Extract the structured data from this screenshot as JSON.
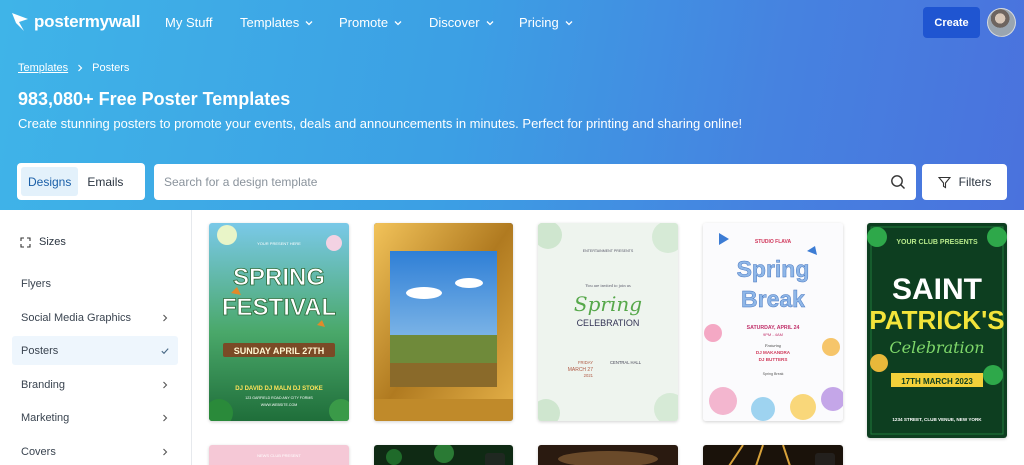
{
  "nav": {
    "logo_text": "postermywall",
    "links": [
      "My Stuff",
      "Templates",
      "Promote",
      "Discover",
      "Pricing"
    ],
    "create_label": "Create"
  },
  "breadcrumb": {
    "root": "Templates",
    "current": "Posters"
  },
  "hero": {
    "title": "983,080+ Free Poster Templates",
    "subtitle": "Create stunning posters to promote your events, deals and announcements in minutes. Perfect for printing and sharing online!"
  },
  "toggle": {
    "designs": "Designs",
    "emails": "Emails"
  },
  "search": {
    "placeholder": "Search for a design template",
    "value": ""
  },
  "filters_label": "Filters",
  "sidebar": {
    "heading": "Sizes",
    "items": [
      {
        "label": "Flyers"
      },
      {
        "label": "Social Media Graphics"
      },
      {
        "label": "Posters"
      },
      {
        "label": "Branding"
      },
      {
        "label": "Marketing"
      },
      {
        "label": "Covers"
      }
    ]
  },
  "templates": {
    "spring_festival": {
      "tagline": "YOUR PRESENT HERE",
      "line1": "SPRING",
      "line2": "FESTIVAL",
      "date": "SUNDAY APRIL 27TH",
      "djs": "DJ DAVID   DJ MALN   DJ STOKE",
      "address": "123 GARFIELD ROAD ANY CITY FORMS",
      "website": "WWW.WEBSITE.COM"
    },
    "spring_celebration": {
      "top": "ENTERTAINMENT PRESENTS",
      "invite": "You are invited to join us",
      "line1": "Spring",
      "line2": "CELEBRATION",
      "date_label": "FRIDAY",
      "date": "MARCH 27",
      "year": "2021",
      "venue": "CENTRAL HALL"
    },
    "spring_break": {
      "studio": "STUDIO FLAVA",
      "line1": "Spring",
      "line2": "Break",
      "date": "SATURDAY, APRIL 24",
      "time": "9PM - 4AM",
      "featuring": "Featuring",
      "dj1": "DJ MAKANDRA",
      "dj2": "DJ BUTTERS",
      "footer": "Spring Break"
    },
    "saint_patricks": {
      "top": "YOUR CLUB PRESENTS",
      "line1": "SAINT",
      "line2": "PATRICK'S",
      "line3": "Celebration",
      "date": "17TH MARCH 2023",
      "address": "1234 STREET, CLUB VENUE, NEW YORK"
    },
    "row2": {
      "club": "NEWS CLUB PRESENT"
    }
  }
}
